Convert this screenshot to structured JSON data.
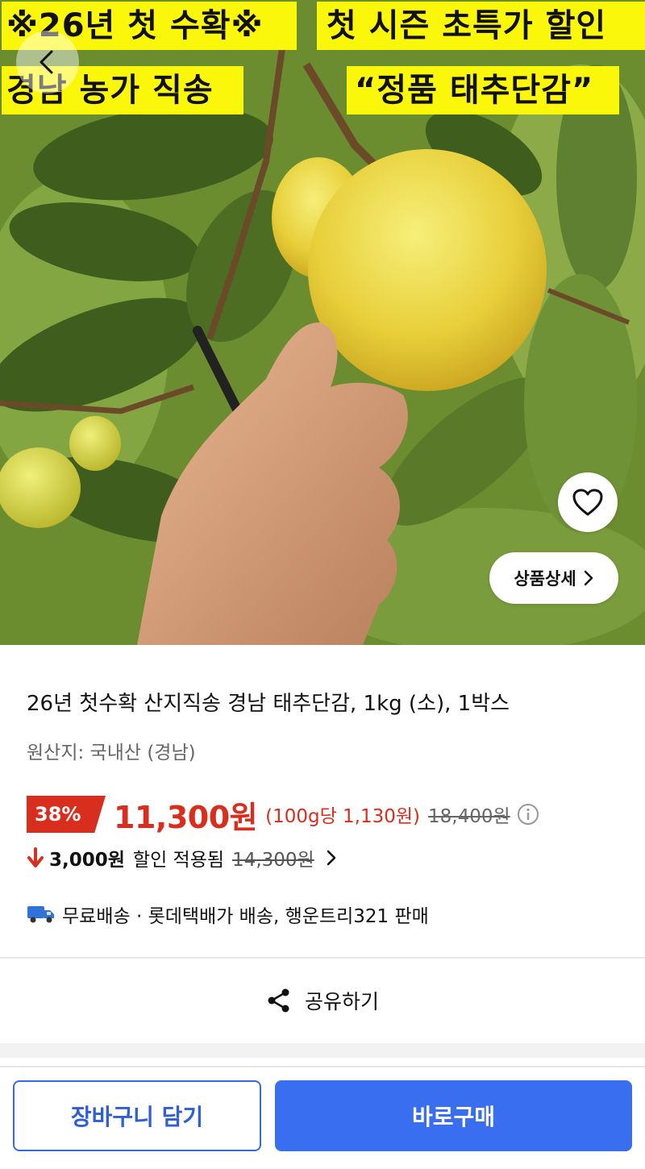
{
  "hero": {
    "banner_line1_left": "※26년 첫 수확※",
    "banner_line1_right": "첫 시즌 초특가 할인",
    "banner_line2_left": "경남 농가 직송",
    "banner_line2_right": "“정품 태추단감”",
    "detail_button_label": "상품상세",
    "icons": {
      "back": "chevron-left-icon",
      "favorite": "heart-outline-icon",
      "detail": "chevron-right-icon"
    }
  },
  "product": {
    "title": "26년 첫수확 산지직송 경남 태추단감, 1kg (소), 1박스",
    "origin": "원산지: 국내산 (경남)"
  },
  "pricing": {
    "discount_rate": "38%",
    "price": "11,300원",
    "unit_price": "(100g당 1,130원)",
    "original_price": "18,400원",
    "info_icon": "info-circle-icon"
  },
  "coupon": {
    "amount": "3,000원",
    "label": "할인 적용됨",
    "before_price": "14,300원",
    "icons": {
      "down_arrow": "down-arrow-icon",
      "chevron": "chevron-right-icon"
    }
  },
  "delivery": {
    "text": "무료배송 · 롯데택배가 배송, 행운트리321 판매",
    "icon": "truck-icon"
  },
  "share": {
    "label": "공유하기",
    "icon": "share-icon"
  },
  "actions": {
    "cart_label": "장바구니 담기",
    "buy_label": "바로구매"
  },
  "colors": {
    "banner_yellow": "#fbf70a",
    "sale_red": "#d92e1d",
    "primary_blue": "#3a6ef0",
    "cart_border_blue": "#3469e8"
  }
}
